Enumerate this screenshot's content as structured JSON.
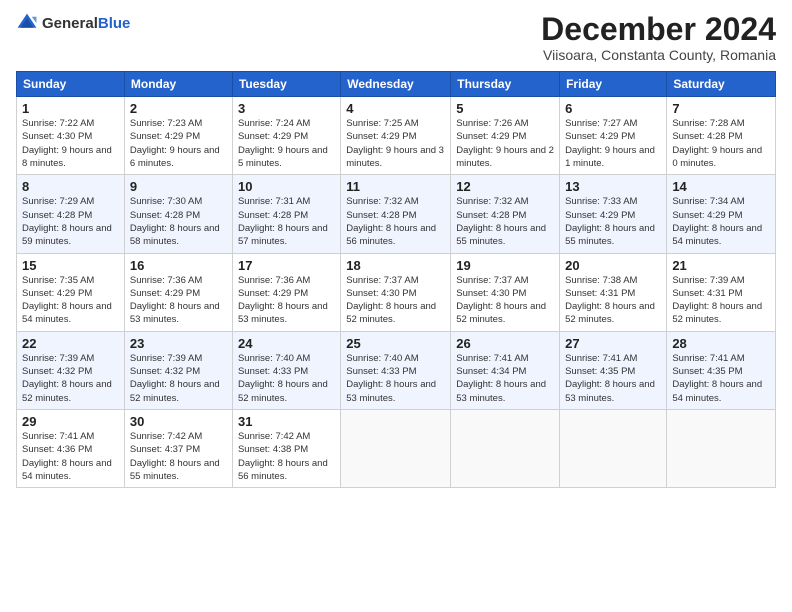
{
  "logo": {
    "general": "General",
    "blue": "Blue"
  },
  "title": "December 2024",
  "subtitle": "Viisoara, Constanta County, Romania",
  "days_header": [
    "Sunday",
    "Monday",
    "Tuesday",
    "Wednesday",
    "Thursday",
    "Friday",
    "Saturday"
  ],
  "weeks": [
    [
      {
        "day": "1",
        "sunrise": "7:22 AM",
        "sunset": "4:30 PM",
        "daylight": "9 hours and 8 minutes."
      },
      {
        "day": "2",
        "sunrise": "7:23 AM",
        "sunset": "4:29 PM",
        "daylight": "9 hours and 6 minutes."
      },
      {
        "day": "3",
        "sunrise": "7:24 AM",
        "sunset": "4:29 PM",
        "daylight": "9 hours and 5 minutes."
      },
      {
        "day": "4",
        "sunrise": "7:25 AM",
        "sunset": "4:29 PM",
        "daylight": "9 hours and 3 minutes."
      },
      {
        "day": "5",
        "sunrise": "7:26 AM",
        "sunset": "4:29 PM",
        "daylight": "9 hours and 2 minutes."
      },
      {
        "day": "6",
        "sunrise": "7:27 AM",
        "sunset": "4:29 PM",
        "daylight": "9 hours and 1 minute."
      },
      {
        "day": "7",
        "sunrise": "7:28 AM",
        "sunset": "4:28 PM",
        "daylight": "9 hours and 0 minutes."
      }
    ],
    [
      {
        "day": "8",
        "sunrise": "7:29 AM",
        "sunset": "4:28 PM",
        "daylight": "8 hours and 59 minutes."
      },
      {
        "day": "9",
        "sunrise": "7:30 AM",
        "sunset": "4:28 PM",
        "daylight": "8 hours and 58 minutes."
      },
      {
        "day": "10",
        "sunrise": "7:31 AM",
        "sunset": "4:28 PM",
        "daylight": "8 hours and 57 minutes."
      },
      {
        "day": "11",
        "sunrise": "7:32 AM",
        "sunset": "4:28 PM",
        "daylight": "8 hours and 56 minutes."
      },
      {
        "day": "12",
        "sunrise": "7:32 AM",
        "sunset": "4:28 PM",
        "daylight": "8 hours and 55 minutes."
      },
      {
        "day": "13",
        "sunrise": "7:33 AM",
        "sunset": "4:29 PM",
        "daylight": "8 hours and 55 minutes."
      },
      {
        "day": "14",
        "sunrise": "7:34 AM",
        "sunset": "4:29 PM",
        "daylight": "8 hours and 54 minutes."
      }
    ],
    [
      {
        "day": "15",
        "sunrise": "7:35 AM",
        "sunset": "4:29 PM",
        "daylight": "8 hours and 54 minutes."
      },
      {
        "day": "16",
        "sunrise": "7:36 AM",
        "sunset": "4:29 PM",
        "daylight": "8 hours and 53 minutes."
      },
      {
        "day": "17",
        "sunrise": "7:36 AM",
        "sunset": "4:29 PM",
        "daylight": "8 hours and 53 minutes."
      },
      {
        "day": "18",
        "sunrise": "7:37 AM",
        "sunset": "4:30 PM",
        "daylight": "8 hours and 52 minutes."
      },
      {
        "day": "19",
        "sunrise": "7:37 AM",
        "sunset": "4:30 PM",
        "daylight": "8 hours and 52 minutes."
      },
      {
        "day": "20",
        "sunrise": "7:38 AM",
        "sunset": "4:31 PM",
        "daylight": "8 hours and 52 minutes."
      },
      {
        "day": "21",
        "sunrise": "7:39 AM",
        "sunset": "4:31 PM",
        "daylight": "8 hours and 52 minutes."
      }
    ],
    [
      {
        "day": "22",
        "sunrise": "7:39 AM",
        "sunset": "4:32 PM",
        "daylight": "8 hours and 52 minutes."
      },
      {
        "day": "23",
        "sunrise": "7:39 AM",
        "sunset": "4:32 PM",
        "daylight": "8 hours and 52 minutes."
      },
      {
        "day": "24",
        "sunrise": "7:40 AM",
        "sunset": "4:33 PM",
        "daylight": "8 hours and 52 minutes."
      },
      {
        "day": "25",
        "sunrise": "7:40 AM",
        "sunset": "4:33 PM",
        "daylight": "8 hours and 53 minutes."
      },
      {
        "day": "26",
        "sunrise": "7:41 AM",
        "sunset": "4:34 PM",
        "daylight": "8 hours and 53 minutes."
      },
      {
        "day": "27",
        "sunrise": "7:41 AM",
        "sunset": "4:35 PM",
        "daylight": "8 hours and 53 minutes."
      },
      {
        "day": "28",
        "sunrise": "7:41 AM",
        "sunset": "4:35 PM",
        "daylight": "8 hours and 54 minutes."
      }
    ],
    [
      {
        "day": "29",
        "sunrise": "7:41 AM",
        "sunset": "4:36 PM",
        "daylight": "8 hours and 54 minutes."
      },
      {
        "day": "30",
        "sunrise": "7:42 AM",
        "sunset": "4:37 PM",
        "daylight": "8 hours and 55 minutes."
      },
      {
        "day": "31",
        "sunrise": "7:42 AM",
        "sunset": "4:38 PM",
        "daylight": "8 hours and 56 minutes."
      },
      null,
      null,
      null,
      null
    ]
  ]
}
